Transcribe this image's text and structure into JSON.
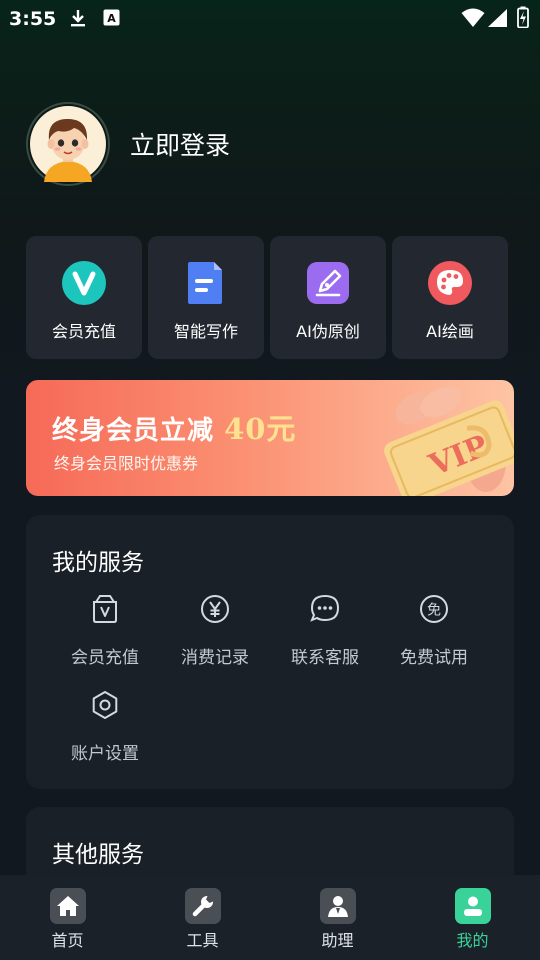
{
  "status_bar": {
    "time": "3:55"
  },
  "profile": {
    "login_text": "立即登录"
  },
  "quick_actions": [
    {
      "label": "会员充值",
      "icon": "vip-v-icon"
    },
    {
      "label": "智能写作",
      "icon": "document-icon"
    },
    {
      "label": "AI伪原创",
      "icon": "pen-nib-icon"
    },
    {
      "label": "AI绘画",
      "icon": "palette-icon"
    }
  ],
  "banner": {
    "title": "终身会员立减",
    "amount": "40元",
    "subtitle": "终身会员限时优惠券",
    "ticket_text": "VIP"
  },
  "my_services": {
    "title": "我的服务",
    "items": [
      {
        "label": "会员充值",
        "icon": "vip-bag-icon"
      },
      {
        "label": "消费记录",
        "icon": "yen-icon"
      },
      {
        "label": "联系客服",
        "icon": "chat-icon"
      },
      {
        "label": "免费试用",
        "icon": "free-icon"
      },
      {
        "label": "账户设置",
        "icon": "settings-icon"
      }
    ]
  },
  "other_services": {
    "title": "其他服务"
  },
  "bottom_nav": [
    {
      "label": "首页",
      "icon": "home-icon",
      "active": false
    },
    {
      "label": "工具",
      "icon": "wrench-icon",
      "active": false
    },
    {
      "label": "助理",
      "icon": "assistant-icon",
      "active": false
    },
    {
      "label": "我的",
      "icon": "user-icon",
      "active": true
    }
  ],
  "colors": {
    "accent": "#39d39a",
    "card_bg": "#232830",
    "banner_start": "#f66a58",
    "banner_end": "#fdc4a4"
  }
}
